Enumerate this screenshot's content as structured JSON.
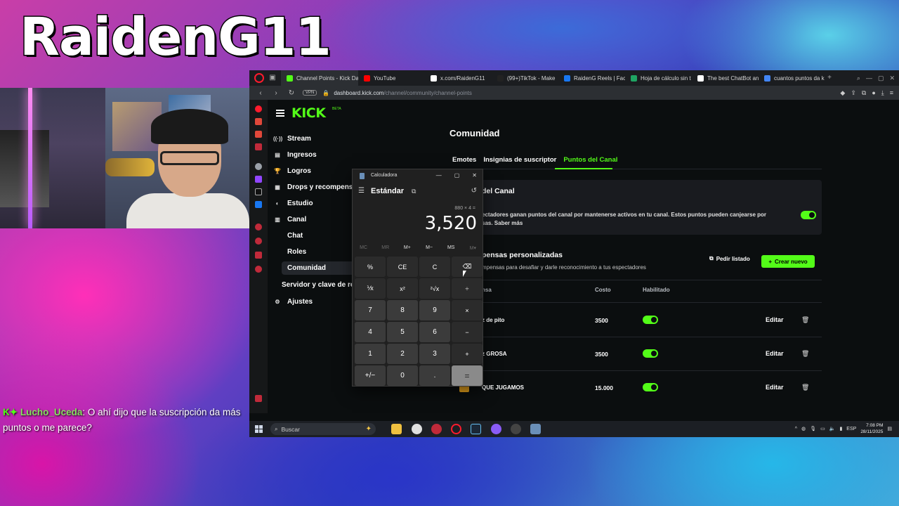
{
  "overlay": {
    "streamer_name": "RaidenG11",
    "chat": {
      "badge": "K✦",
      "user": "Lucho_Uceda",
      "message": ": O ahí dijo que la suscripción da más puntos o me parece?"
    }
  },
  "browser": {
    "tabs": [
      {
        "title": "Channel Points - Kick Da",
        "color": "#53fc18",
        "active": true
      },
      {
        "title": "YouTube",
        "color": "#ff0000",
        "active": false
      },
      {
        "title": "x.com/RaidenG11",
        "color": "#ffffff",
        "active": false
      },
      {
        "title": "(99+)TikTok - Make",
        "color": "#222222",
        "active": false
      },
      {
        "title": "RaidenG Reels | Face",
        "color": "#1877f2",
        "active": false
      },
      {
        "title": "Hoja de cálculo sin t",
        "color": "#1fa463",
        "active": false
      },
      {
        "title": "The best ChatBot an",
        "color": "#ffffff",
        "active": false
      },
      {
        "title": "cuantos puntos da k",
        "color": "#4285f4",
        "active": false
      }
    ],
    "address": {
      "vpn": "VPN",
      "domain": "dashboard.kick.com",
      "path": "/channel/community/channel-points"
    }
  },
  "kick": {
    "logo": "KICK",
    "beta": "BETA",
    "nav": [
      {
        "label": "Stream",
        "icon": "((·))"
      },
      {
        "label": "Ingresos",
        "icon": "▤"
      },
      {
        "label": "Logros",
        "icon": "🏆"
      },
      {
        "label": "Drops y recompensas",
        "icon": "▦"
      },
      {
        "label": "Estudio",
        "icon": "◐"
      },
      {
        "label": "Canal",
        "icon": "▥"
      }
    ],
    "canal_sub": [
      "Chat",
      "Roles",
      "Comunidad",
      "Servidor y clave de retransmisión"
    ],
    "settings": {
      "label": "Ajustes",
      "icon": "⚙"
    },
    "page_title": "Comunidad",
    "tabs": [
      "Emotes",
      "Insignias de suscriptor",
      "Puntos del Canal"
    ],
    "card": {
      "title": "del Canal",
      "description": "ectadores ganan puntos del canal por mantenerse activos en tu canal. Estos puntos pueden canjearse por sas. Saber más"
    },
    "rewards_section": {
      "title": "pensas personalizadas",
      "subtitle": "mpensas para desafiar y darle reconocimiento a tus espectadores",
      "list_button": "Pedir listado",
      "create_button": "Crear nuevo",
      "columns": [
        "nsa",
        "Costo",
        "Habilitado"
      ],
      "rows": [
        {
          "name": "z de pito",
          "cost": "3500",
          "edit": "Editar"
        },
        {
          "name": "z GROSA",
          "cost": "3500",
          "edit": "Editar"
        },
        {
          "name": "QUE JUGAMOS",
          "cost": "15.000",
          "edit": "Editar"
        }
      ]
    }
  },
  "calculator": {
    "title": "Calculadora",
    "mode": "Estándar",
    "expression": "880 × 4 =",
    "display": "3,520",
    "memory": [
      "MC",
      "MR",
      "M+",
      "M−",
      "MS",
      "M▾"
    ],
    "keys": [
      "%",
      "CE",
      "C",
      "⌫",
      "⅟x",
      "x²",
      "²√x",
      "÷",
      "7",
      "8",
      "9",
      "×",
      "4",
      "5",
      "6",
      "−",
      "1",
      "2",
      "3",
      "+",
      "+/−",
      "0",
      ".",
      "="
    ]
  },
  "taskbar": {
    "search_placeholder": "Buscar",
    "lang": "ESP",
    "time": "7:08 PM",
    "date": "28/11/2025"
  }
}
